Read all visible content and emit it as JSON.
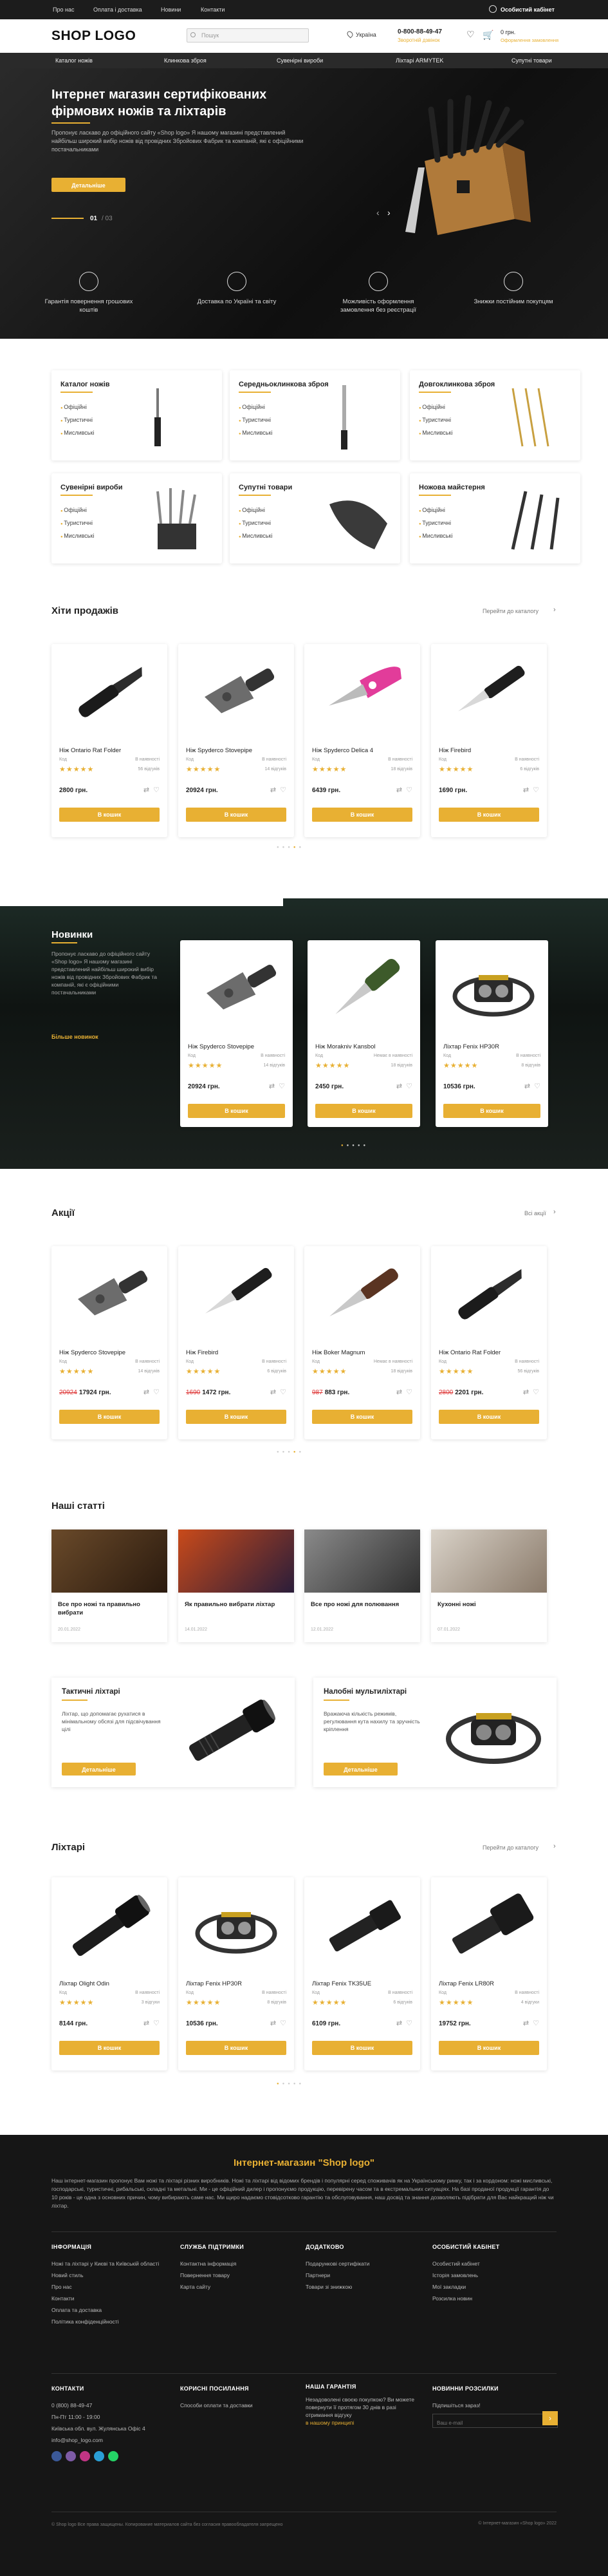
{
  "topbar": {
    "links": [
      "Про нас",
      "Оплата і доставка",
      "Новини",
      "Контакти"
    ],
    "account": "Особистий кабінет"
  },
  "header": {
    "logo": "SHOP LOGO",
    "search_placeholder": "Пошук",
    "region": "Україна",
    "phone": "0-800-88-49-47",
    "callback": "Зворотній дзвінок",
    "cart_count": "0 грн.",
    "cart_label": "Оформлення замовлення"
  },
  "nav": [
    "Каталог ножів",
    "Клинкова зброя",
    "Сувенірні вироби",
    "Ліхтарі ARMYTEK",
    "Супутні товари"
  ],
  "hero": {
    "title": "Інтернет магазин сертифікованих фірмових ножів та ліхтарів",
    "desc": "Пропонує ласкаво до офіційного сайту «Shop logo» Я нашому магазині представлений найбільш широкий вибір ножів від провідних Збройових Фабрик та компаній, які є офіційними постачальниками",
    "button": "Детальніше",
    "slide": "01",
    "slides_total": "/ 03"
  },
  "features": [
    "Гарантія повернення грошових коштів",
    "Доставка по Україні та світу",
    "Можливість оформлення замовлення без реєстрації",
    "Знижки постійним покупцям"
  ],
  "categories": [
    {
      "title": "Каталог ножів",
      "items": [
        "Офіційні",
        "Туристичні",
        "Мисливські"
      ]
    },
    {
      "title": "Середньоклинкова зброя",
      "items": [
        "Офіційні",
        "Туристичні",
        "Мисливські"
      ]
    },
    {
      "title": "Довгоклинкова зброя",
      "items": [
        "Офіційні",
        "Туристичні",
        "Мисливські"
      ]
    },
    {
      "title": "Сувенірні вироби",
      "items": [
        "Офіційні",
        "Туристичні",
        "Мисливські"
      ]
    },
    {
      "title": "Супутні товари",
      "items": [
        "Офіційні",
        "Туристичні",
        "Мисливські"
      ]
    },
    {
      "title": "Ножова майстерня",
      "items": [
        "Офіційні",
        "Туристичні",
        "Мисливські"
      ]
    }
  ],
  "bestsellers": {
    "title": "Хіти продажів",
    "link": "Перейти до каталогу",
    "products": [
      {
        "name": "Ніж Ontario Rat Folder",
        "sku": "Код",
        "stock": "В наявності",
        "stars": "★★★★★",
        "reviews": "56 відгуків",
        "price": "2800 грн.",
        "old": "",
        "buy": "В кошик"
      },
      {
        "name": "Ніж Spyderco Stovepipe",
        "sku": "Код",
        "stock": "В наявності",
        "stars": "★★★★★",
        "reviews": "14 відгуків",
        "price": "20924 грн.",
        "old": "",
        "buy": "В кошик"
      },
      {
        "name": "Ніж Spyderco Delica 4",
        "sku": "Код",
        "stock": "В наявності",
        "stars": "★★★★★",
        "reviews": "18 відгуків",
        "price": "6439 грн.",
        "old": "",
        "buy": "В кошик"
      },
      {
        "name": "Ніж Firebird",
        "sku": "Код",
        "stock": "В наявності",
        "stars": "★★★★★",
        "reviews": "6 відгуків",
        "price": "1690 грн.",
        "old": "",
        "buy": "В кошик"
      }
    ]
  },
  "novelty": {
    "title": "Новинки",
    "desc": "Пропонує ласкаво до офіційного сайту «Shop logo» Я нашому магазині представлений найбільш широкий вибір ножів від провідних Збройових Фабрик та компаній, які є офіційними постачальниками",
    "link": "Більше новинок",
    "products": [
      {
        "name": "Ніж Spyderco Stovepipe",
        "sku": "Код",
        "stock": "В наявності",
        "stars": "★★★★★",
        "reviews": "14 відгуків",
        "price": "20924 грн.",
        "old": "",
        "buy": "В кошик"
      },
      {
        "name": "Ніж Morakniv Kansbol",
        "sku": "Код",
        "stock": "Немає в наявності",
        "stars": "★★★★★",
        "reviews": "18 відгуків",
        "price": "2450 грн.",
        "old": "",
        "buy": "В кошик"
      },
      {
        "name": "Ліхтар Fenix HP30R",
        "sku": "Код",
        "stock": "В наявності",
        "stars": "★★★★★",
        "reviews": "8 відгуків",
        "price": "10536 грн.",
        "old": "",
        "buy": "В кошик"
      }
    ]
  },
  "sales": {
    "title": "Акції",
    "link": "Всі акції",
    "products": [
      {
        "name": "Ніж Spyderco Stovepipe",
        "sku": "Код",
        "stock": "В наявності",
        "stars": "★★★★★",
        "reviews": "14 відгуків",
        "price": "17924 грн.",
        "old": "20924",
        "buy": "В кошик"
      },
      {
        "name": "Ніж Firebird",
        "sku": "Код",
        "stock": "В наявності",
        "stars": "★★★★★",
        "reviews": "6 відгуків",
        "price": "1472 грн.",
        "old": "1690",
        "buy": "В кошик"
      },
      {
        "name": "Ніж Boker Magnum",
        "sku": "Код",
        "stock": "Немає в наявності",
        "stars": "★★★★★",
        "reviews": "18 відгуків",
        "price": "883 грн.",
        "old": "987",
        "buy": "В кошик"
      },
      {
        "name": "Ніж Ontario Rat Folder",
        "sku": "Код",
        "stock": "В наявності",
        "stars": "★★★★★",
        "reviews": "56 відгуків",
        "price": "2201 грн.",
        "old": "2800",
        "buy": "В кошик"
      }
    ]
  },
  "articles": {
    "title": "Наші статті",
    "items": [
      {
        "title": "Все про ножі та правильно вибрати",
        "date": "20.01.2022"
      },
      {
        "title": "Як правильно вибрати ліхтар",
        "date": "14.01.2022"
      },
      {
        "title": "Все про ножі для полювання",
        "date": "12.01.2022"
      },
      {
        "title": "Кухонні ножі",
        "date": "07.01.2022"
      }
    ]
  },
  "banners": [
    {
      "title": "Тактичні ліхтарі",
      "desc": "Ліхтар, що допомагає рухатися в мінімальному обсязі для підсвічування цілі",
      "button": "Детальніше"
    },
    {
      "title": "Налобні мультиліхтарі",
      "desc": "Вражаюча кількість режимів, регулювання кута нахилу та зручність кріплення",
      "button": "Детальніше"
    }
  ],
  "lights": {
    "title": "Ліхтарі",
    "link": "Перейти до каталогу",
    "products": [
      {
        "name": "Ліхтар Olight Odin",
        "sku": "Код",
        "stock": "В наявності",
        "stars": "★★★★★",
        "reviews": "3 відгуки",
        "price": "8144 грн.",
        "old": "",
        "buy": "В кошик"
      },
      {
        "name": "Ліхтар Fenix HP30R",
        "sku": "Код",
        "stock": "В наявності",
        "stars": "★★★★★",
        "reviews": "8 відгуків",
        "price": "10536 грн.",
        "old": "",
        "buy": "В кошик"
      },
      {
        "name": "Ліхтар Fenix TK35UE",
        "sku": "Код",
        "stock": "В наявності",
        "stars": "★★★★★",
        "reviews": "6 відгуків",
        "price": "6109 грн.",
        "old": "",
        "buy": "В кошик"
      },
      {
        "name": "Ліхтар Fenix LR80R",
        "sku": "Код",
        "stock": "В наявності",
        "stars": "★★★★★",
        "reviews": "4 відгуки",
        "price": "19752 грн.",
        "old": "",
        "buy": "В кошик"
      }
    ]
  },
  "about": {
    "title": "Інтернет-магазин \"Shop logo\"",
    "text": "Наш інтернет-магазин пропонує Вам ножі та ліхтарі різних виробників. Ножі та ліхтарі від відомих брендів і популярні серед споживачів як на Українському ринку, так і за кордоном: ножі мисливські, господарські, туристичні, рибальські, складні та метальні. Ми - це офіційний дилер і пропонуємо продукцію, перевірену часом та в екстремальних ситуаціях. На базі проданої продукції гарантія до 10 років - це одна з основних причин, чому вибирають саме нас. Ми щиро надаємо стовідсотково гарантію та обслуговування, наш досвід та знання дозволяють підібрати для Вас найкращий ніж чи ліхтар."
  },
  "footer": {
    "info": {
      "title": "ІНФОРМАЦІЯ",
      "items": [
        "Ножі та ліхтарі у Києві та Київській області",
        "Новий стиль",
        "Про нас",
        "Контакти",
        "Оплата та доставка",
        "Політика конфіденційності"
      ]
    },
    "service": {
      "title": "СЛУЖБА ПІДТРИМКИ",
      "items": [
        "Контактна інформація",
        "Повернення товару",
        "Карта сайту"
      ]
    },
    "extra": {
      "title": "ДОДАТКОВО",
      "items": [
        "Подарункові сертифікати",
        "Партнери",
        "Товари зі знижкою"
      ]
    },
    "account": {
      "title": "ОСОБИСТИЙ КАБІНЕТ",
      "items": [
        "Особистий кабінет",
        "Історія замовлень",
        "Мої закладки",
        "Розсилка новин"
      ]
    },
    "contacts": {
      "title": "КОНТАКТИ",
      "phone": "0 (800) 88-49-47",
      "hours": "Пн-Пт 11:00 - 19:00",
      "address": "Київська обл. вул. Жулянська Офіс 4",
      "email": "info@shop_logo.com"
    },
    "useful": {
      "title": "КОРИСНІ ПОСИЛАННЯ",
      "items": [
        "Способи оплати та доставки"
      ]
    },
    "guarantee": {
      "title": "НАША ГАРАНТІЯ",
      "text": "Незадоволені своєю покупкою? Ви можете повернути її протягом 30 днів в разі отримання відгуку",
      "link": "в нашому принципі"
    },
    "newsletter": {
      "title": "НОВИННИ РОЗСИЛКИ",
      "label": "Підпишіться зараз!",
      "placeholder": "Ваш e-mail"
    },
    "copy_left": "© Shop logo Все права защищены. Копирование материалов сайта без согласия правообладателя запрещено",
    "copy_right": "© Інтернет-магазин «Shop logo» 2022"
  }
}
